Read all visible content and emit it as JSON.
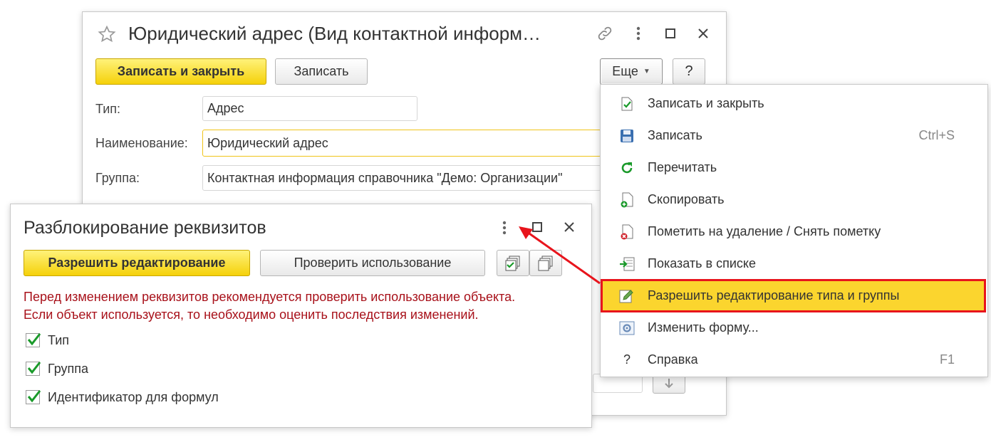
{
  "main_window": {
    "title": "Юридический адрес (Вид контактной информ…",
    "buttons": {
      "save_close": "Записать и закрыть",
      "save": "Записать",
      "more": "Еще",
      "help": "?"
    },
    "fields": {
      "type_label": "Тип:",
      "type_value": "Адрес",
      "name_label": "Наименование:",
      "name_value": "Юридический адрес",
      "group_label": "Группа:",
      "group_value": "Контактная информация справочника \"Демо: Организации\""
    }
  },
  "more_menu": {
    "items": [
      {
        "label": "Записать и закрыть",
        "shortcut": "",
        "icon": "save-close-icon"
      },
      {
        "label": "Записать",
        "shortcut": "Ctrl+S",
        "icon": "floppy-icon"
      },
      {
        "label": "Перечитать",
        "shortcut": "",
        "icon": "refresh-icon"
      },
      {
        "label": "Скопировать",
        "shortcut": "",
        "icon": "copy-icon"
      },
      {
        "label": "Пометить на удаление / Снять пометку",
        "shortcut": "",
        "icon": "delete-mark-icon"
      },
      {
        "label": "Показать в списке",
        "shortcut": "",
        "icon": "show-in-list-icon"
      },
      {
        "label": "Разрешить редактирование типа и группы",
        "shortcut": "",
        "icon": "edit-pencil-icon",
        "highlighted": true
      },
      {
        "label": "Изменить форму...",
        "shortcut": "",
        "icon": "form-settings-icon"
      },
      {
        "label": "Справка",
        "shortcut": "F1",
        "icon": "question-icon"
      }
    ]
  },
  "dialog": {
    "title": "Разблокирование реквизитов",
    "buttons": {
      "allow_edit": "Разрешить редактирование",
      "check_usage": "Проверить использование"
    },
    "warning_line1": "Перед изменением реквизитов рекомендуется проверить использование объекта.",
    "warning_line2": "Если объект используется, то необходимо оценить последствия изменений.",
    "checkboxes": [
      {
        "label": "Тип",
        "checked": true
      },
      {
        "label": "Группа",
        "checked": true
      },
      {
        "label": "Идентификатор для формул",
        "checked": true
      }
    ]
  },
  "colors": {
    "accent_yellow": "#f5d10a",
    "highlight_red": "#e8141c",
    "warning_text": "#a8111a",
    "check_green": "#1a9a2a"
  }
}
